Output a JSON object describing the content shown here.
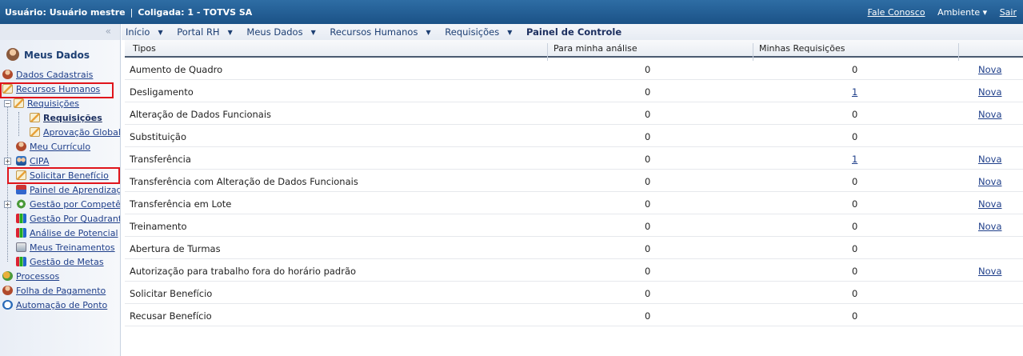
{
  "topbar": {
    "user": "Usuário: Usuário mestre",
    "separator": "|",
    "company": "Coligada: 1 - TOTVS SA",
    "contact": "Fale Conosco",
    "environment": "Ambiente ▾",
    "logout": "Sair"
  },
  "sidebar": {
    "collapse": "«",
    "title": "Meus Dados",
    "items": {
      "dados": "Dados Cadastrais",
      "rh": "Recursos Humanos",
      "requisicoes": "Requisições",
      "requisicoes_sub": "Requisições",
      "aprovacao": "Aprovação Global",
      "curriculo": "Meu Currículo",
      "cipa": "CIPA",
      "beneficio": "Solicitar Benefício",
      "painel_aprend": "Painel de Aprendizagem",
      "competencias": "Gestão por Competências",
      "quadrante": "Gestão Por Quadrante",
      "potencial": "Análise de Potencial",
      "treinamentos": "Meus Treinamentos",
      "metas": "Gestão de Metas",
      "processos": "Processos",
      "folha": "Folha de Pagamento",
      "ponto": "Automação de Ponto"
    }
  },
  "breadcrumb": {
    "inicio": "Início",
    "portal": "Portal RH",
    "meus": "Meus Dados",
    "rh": "Recursos Humanos",
    "req": "Requisições",
    "current": "Painel de Controle"
  },
  "table": {
    "headers": {
      "tipos": "Tipos",
      "analise": "Para minha análise",
      "minhas": "Minhas Requisições"
    },
    "rows": [
      {
        "tipo": "Aumento de Quadro",
        "analise": "0",
        "minhas": "0",
        "nova": "Nova"
      },
      {
        "tipo": "Desligamento",
        "analise": "0",
        "minhas": "1",
        "nova": "Nova"
      },
      {
        "tipo": "Alteração de Dados Funcionais",
        "analise": "0",
        "minhas": "0",
        "nova": "Nova"
      },
      {
        "tipo": "Substituição",
        "analise": "0",
        "minhas": "0",
        "nova": ""
      },
      {
        "tipo": "Transferência",
        "analise": "0",
        "minhas": "1",
        "nova": "Nova"
      },
      {
        "tipo": "Transferência com Alteração de Dados Funcionais",
        "analise": "0",
        "minhas": "0",
        "nova": "Nova"
      },
      {
        "tipo": "Transferência em Lote",
        "analise": "0",
        "minhas": "0",
        "nova": "Nova"
      },
      {
        "tipo": "Treinamento",
        "analise": "0",
        "minhas": "0",
        "nova": "Nova"
      },
      {
        "tipo": "Abertura de Turmas",
        "analise": "0",
        "minhas": "0",
        "nova": ""
      },
      {
        "tipo": "Autorização para trabalho fora do horário padrão",
        "analise": "0",
        "minhas": "0",
        "nova": "Nova"
      },
      {
        "tipo": "Solicitar Benefício",
        "analise": "0",
        "minhas": "0",
        "nova": ""
      },
      {
        "tipo": "Recusar Benefício",
        "analise": "0",
        "minhas": "0",
        "nova": ""
      }
    ]
  },
  "colors": {
    "topbar": "#1b5287",
    "highlight": "#e0141b",
    "link": "#1f3f8a"
  }
}
